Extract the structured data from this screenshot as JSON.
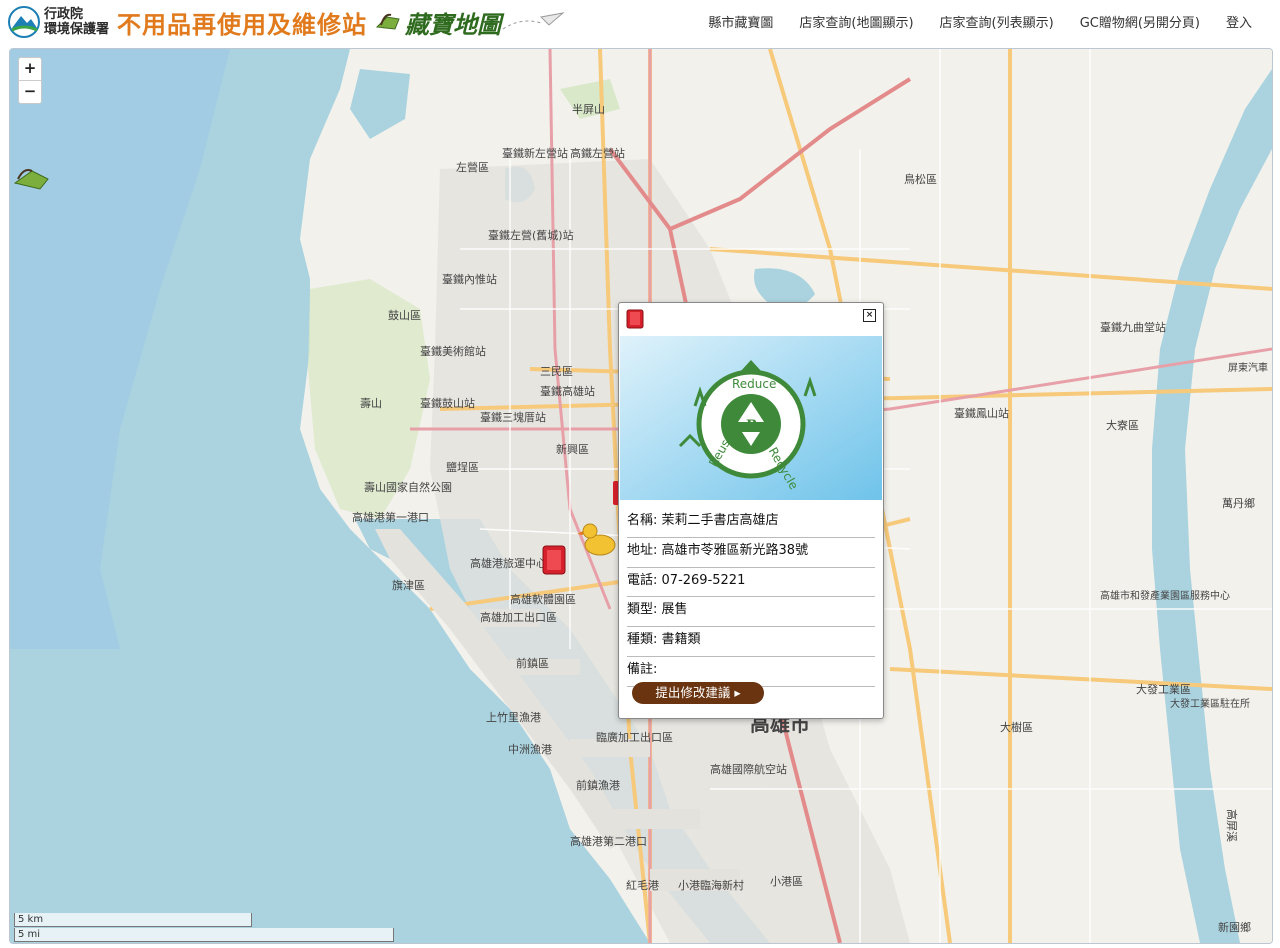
{
  "header": {
    "agency_line1": "行政院",
    "agency_line2": "環境保護署",
    "site_title": "不用品再使用及維修站",
    "treasure_title": "藏寶地圖"
  },
  "nav": [
    {
      "label": "縣市藏寶圖"
    },
    {
      "label": "店家查詢(地圖顯示)"
    },
    {
      "label": "店家查詢(列表顯示)"
    },
    {
      "label": "GC贈物網(另開分頁)"
    },
    {
      "label": "登入"
    }
  ],
  "map": {
    "zoom_in": "+",
    "zoom_out": "−",
    "scale_km": "5 km",
    "scale_mi": "5 mi",
    "labels": {
      "kaohsiung_city": "高雄市",
      "zuoying": "左營區",
      "gushan": "鼓山區",
      "sanmin": "三民區",
      "xinxing": "新興區",
      "yancheng": "鹽埕區",
      "qijin": "旗津區",
      "qianzhen": "前鎮區",
      "xiaogang": "小港區",
      "niaosong": "鳥松區",
      "daliao": "大寮區",
      "dashu": "大樹區",
      "wandan": "萬丹鄉",
      "xinyuan": "新園鄉",
      "banpingshan": "半屏山",
      "shoushan": "壽山",
      "shoushan_park": "壽山國家自然公園",
      "airport": "高雄國際航空站",
      "harbor_1": "高雄港第一港口",
      "harbor_2": "高雄港第二港口",
      "ferry": "高雄港旅運中心",
      "software_park": "高雄軟體園區",
      "epz": "高雄加工出口區",
      "linhai": "臨廣加工出口區",
      "daliao_industry": "大發工業區",
      "xiaogang_terminal": "小港臨海新村",
      "hongmaogang": "紅毛港",
      "zhongzhou": "中洲漁港",
      "shanzhuli": "上竹里漁港",
      "qianzhen_fishing": "前鎮漁港",
      "gaoping_river": "高屏溪",
      "station_zuoying": "臺鐵新左營站",
      "station_zuoying2": "高鐵左營站",
      "station_kaohsiung": "臺鐵高雄站",
      "station_gushan": "臺鐵鼓山站",
      "station_museum": "臺鐵美術館站",
      "station_neiwei": "臺鐵內惟站",
      "station_sankuaicuo": "臺鐵三塊厝站",
      "station_fengshan": "臺鐵鳳山站",
      "station_jiuqutang": "臺鐵九曲堂站",
      "station_zuoying_jiucheng": "臺鐵左營(舊城)站",
      "science_park": "高雄市和發產業園區服務中心",
      "pingtung_auto": "屏東汽車",
      "industry_office": "大發工業區駐在所"
    }
  },
  "popup": {
    "close": "×",
    "recycle_reduce": "Reduce",
    "recycle_reuse": "Reuse",
    "recycle_recycle": "Recycle",
    "recycle_r": "R",
    "name_label": "名稱:",
    "name": "茉莉二手書店高雄店",
    "address_label": "地址:",
    "address": "高雄市苓雅區新光路38號",
    "phone_label": "電話:",
    "phone": "07-269-5221",
    "type_label": "類型:",
    "type": "展售",
    "category_label": "種類:",
    "category": "書籍類",
    "note_label": "備註:",
    "note": "",
    "suggest_button": "提出修改建議 ▸"
  },
  "colors": {
    "sea": "#aad3df",
    "sea_deep": "#9cc8e6",
    "land": "#f2f1ec",
    "road_major": "#f7c97a",
    "road_rail": "#e8a0a8",
    "river": "#aad3df",
    "accent_orange": "#e07a1c",
    "button_brown": "#6a3410"
  }
}
